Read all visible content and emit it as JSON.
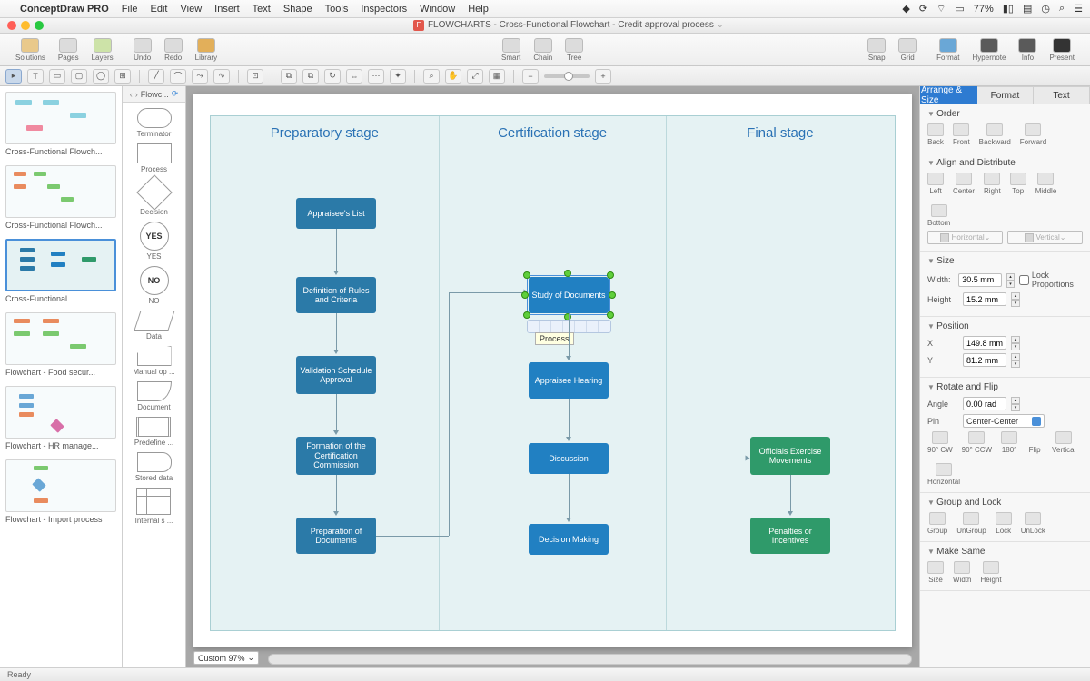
{
  "menubar": {
    "app": "ConceptDraw PRO",
    "items": [
      "File",
      "Edit",
      "View",
      "Insert",
      "Text",
      "Shape",
      "Tools",
      "Inspectors",
      "Window",
      "Help"
    ],
    "battery": "77%"
  },
  "window": {
    "title": "FLOWCHARTS - Cross-Functional Flowchart - Credit approval process"
  },
  "toolbar": {
    "left": [
      {
        "l": "Solutions"
      },
      {
        "l": "Pages"
      },
      {
        "l": "Layers"
      }
    ],
    "undo": [
      {
        "l": "Undo"
      },
      {
        "l": "Redo"
      },
      {
        "l": "Library"
      }
    ],
    "mid": [
      {
        "l": "Smart"
      },
      {
        "l": "Chain"
      },
      {
        "l": "Tree"
      }
    ],
    "snap": [
      {
        "l": "Snap"
      },
      {
        "l": "Grid"
      }
    ],
    "right": [
      {
        "l": "Format"
      },
      {
        "l": "Hypernote"
      },
      {
        "l": "Info"
      },
      {
        "l": "Present"
      }
    ]
  },
  "thumbs": [
    {
      "cap": "Cross-Functional Flowch..."
    },
    {
      "cap": "Cross-Functional Flowch..."
    },
    {
      "cap": "Cross-Functional",
      "sel": true
    },
    {
      "cap": "Flowchart - Food secur..."
    },
    {
      "cap": "Flowchart - HR manage..."
    },
    {
      "cap": "Flowchart - Import process"
    }
  ],
  "shapesHdr": "Flowc...",
  "shapes": [
    {
      "t": "term",
      "l": "Terminator"
    },
    {
      "t": "rect",
      "l": "Process"
    },
    {
      "t": "dec",
      "l": "Decision"
    },
    {
      "t": "yes",
      "l": "YES",
      "txt": "YES"
    },
    {
      "t": "no",
      "l": "NO",
      "txt": "NO"
    },
    {
      "t": "data",
      "l": "Data"
    },
    {
      "t": "manual",
      "l": "Manual op ..."
    },
    {
      "t": "doc",
      "l": "Document"
    },
    {
      "t": "pre",
      "l": "Predefine ..."
    },
    {
      "t": "stored",
      "l": "Stored data"
    },
    {
      "t": "internal",
      "l": "Internal s ..."
    }
  ],
  "canvas": {
    "zoom": "Custom 97%",
    "cols": [
      "Preparatory stage",
      "Certification stage",
      "Final stage"
    ],
    "nodes": {
      "a1": "Appraisee's List",
      "a2": "Definition of Rules and Criteria",
      "a3": "Validation Schedule Approval",
      "a4": "Formation of the Certification Commission",
      "a5": "Preparation of Documents",
      "b1": "Study of Documents",
      "b2": "Appraisee Hearing",
      "b3": "Discussion",
      "b4": "Decision Making",
      "c1": "Officials Exercise Movements",
      "c2": "Penalties or Incentives"
    },
    "tooltip": "Process"
  },
  "inspector": {
    "tabs": [
      "Arrange & Size",
      "Format",
      "Text"
    ],
    "order": {
      "hdr": "Order",
      "btns": [
        "Back",
        "Front",
        "Backward",
        "Forward"
      ]
    },
    "align": {
      "hdr": "Align and Distribute",
      "btns": [
        "Left",
        "Center",
        "Right",
        "Top",
        "Middle",
        "Bottom"
      ],
      "dist": [
        "Horizontal",
        "Vertical"
      ]
    },
    "size": {
      "hdr": "Size",
      "wlab": "Width:",
      "w": "30.5 mm",
      "hlab": "Height",
      "h": "15.2 mm",
      "lock": "Lock Proportions"
    },
    "pos": {
      "hdr": "Position",
      "xlab": "X",
      "x": "149.8 mm",
      "ylab": "Y",
      "y": "81.2 mm"
    },
    "rot": {
      "hdr": "Rotate and Flip",
      "alab": "Angle",
      "a": "0.00 rad",
      "plab": "Pin",
      "pin": "Center-Center",
      "btns": [
        "90° CW",
        "90° CCW",
        "180°"
      ],
      "flip": "Flip",
      "flipb": [
        "Vertical",
        "Horizontal"
      ]
    },
    "grp": {
      "hdr": "Group and Lock",
      "btns": [
        "Group",
        "UnGroup",
        "Lock",
        "UnLock"
      ]
    },
    "same": {
      "hdr": "Make Same",
      "btns": [
        "Size",
        "Width",
        "Height"
      ]
    }
  },
  "status": "Ready"
}
